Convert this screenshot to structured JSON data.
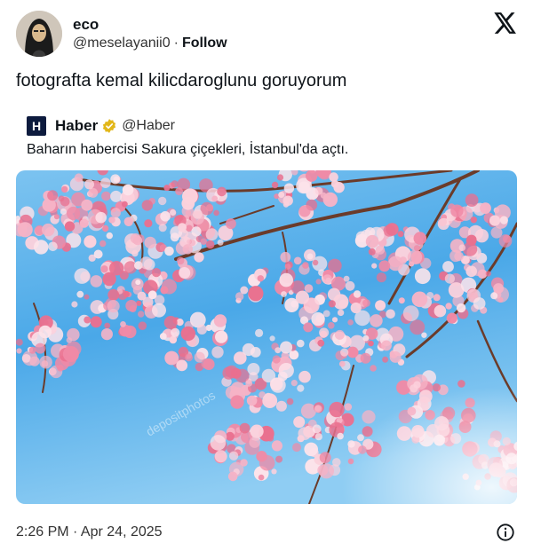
{
  "author": {
    "display_name": "eco",
    "handle": "@meselayanii0",
    "separator": "·",
    "follow_label": "Follow"
  },
  "tweet": {
    "text": "fotografta kemal kilicdaroglunu goruyorum",
    "timestamp": "2:26 PM · Apr 24, 2025"
  },
  "quoted": {
    "logo_letter": "H",
    "name": "Haber",
    "handle": "@Haber",
    "text": "Baharın habercisi Sakura çiçekleri, İstanbul'da açtı.",
    "verified_color": "#e2b719"
  },
  "photo": {
    "watermark": "depositphotos",
    "sky_color": "#4aa8e8",
    "blossom_color": "#f08aa6"
  },
  "icons": {
    "brand": "x-logo-icon",
    "info": "info-icon",
    "verified": "verified-badge-icon"
  }
}
